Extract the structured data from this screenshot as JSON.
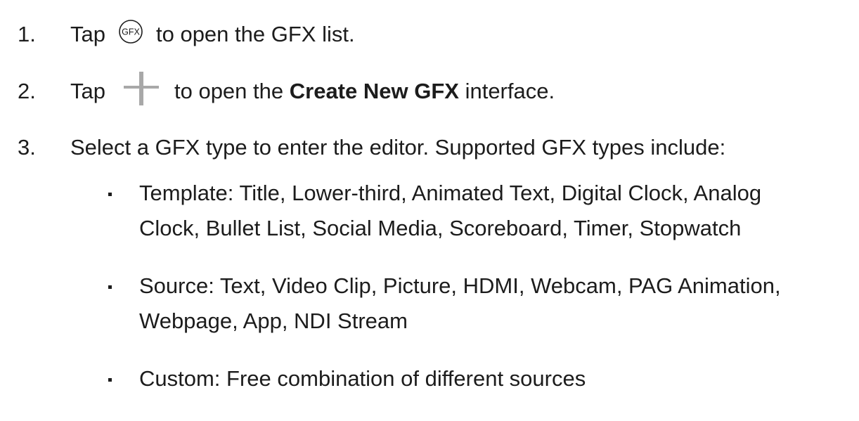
{
  "steps": [
    {
      "num": "1.",
      "pre": "Tap",
      "icon": "gfx-icon",
      "icon_text": "GFX",
      "post": "to open the GFX list."
    },
    {
      "num": "2.",
      "pre": "Tap",
      "icon": "plus-icon",
      "post_a": "to open the",
      "post_bold": "Create New GFX",
      "post_b": "interface."
    },
    {
      "num": "3.",
      "text": "Select a GFX type to enter the editor. Supported GFX types include:"
    }
  ],
  "bullets": [
    {
      "line1": "Template: Title, Lower-third, Animated Text, Digital Clock, Analog",
      "line2": "Clock, Bullet List, Social Media, Scoreboard, Timer, Stopwatch"
    },
    {
      "line1": "Source: Text, Video Clip, Picture, HDMI, Webcam, PAG Animation,",
      "line2": "Webpage, App, NDI Stream"
    },
    {
      "line1": "Custom: Free combination of different sources"
    }
  ]
}
